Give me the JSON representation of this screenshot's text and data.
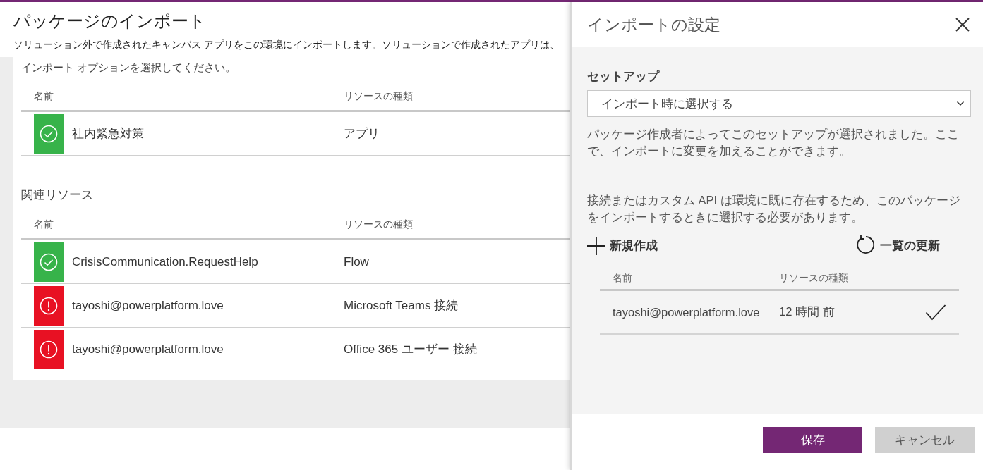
{
  "page": {
    "title": "パッケージのインポート",
    "description": "ソリューション外で作成されたキャンバス アプリをこの環境にインポートします。ソリューションで作成されたアプリは、"
  },
  "import_options": {
    "instruction": "インポート オプションを選択してください。",
    "columns": [
      "名前",
      "リソースの種類"
    ],
    "rows": [
      {
        "name": "社内緊急対策",
        "type": "アプリ",
        "kind": "success"
      }
    ]
  },
  "related_resources": {
    "title": "関連リソース",
    "columns": [
      "名前",
      "リソースの種類"
    ],
    "rows": [
      {
        "name": "CrisisCommunication.RequestHelp",
        "type": "Flow",
        "kind": "success"
      },
      {
        "name": "tayoshi@powerplatform.love",
        "type": "Microsoft Teams 接続",
        "kind": "error"
      },
      {
        "name": "tayoshi@powerplatform.love",
        "type": "Office 365 ユーザー 接続",
        "kind": "error"
      }
    ]
  },
  "settings_panel": {
    "title": "インポートの設定",
    "setup": {
      "label": "セットアップ",
      "value": "インポート時に選択する"
    },
    "setup_note": "パッケージ作成者によってこのセットアップが選択されました。ここで、インポートに変更を加えることができます。",
    "connection_note": "接続またはカスタム API は環境に既に存在するため、このパッケージをインポートするときに選択する必要があります。",
    "actions": [
      {
        "kind": "add",
        "label": "新規作成"
      },
      {
        "kind": "refresh",
        "label": "一覧の更新"
      }
    ],
    "table": {
      "columns": [
        "名前",
        "リソースの種類"
      ],
      "rows": [
        {
          "name": "tayoshi@powerplatform.love",
          "time": "12 時間 前",
          "selected": true
        }
      ]
    },
    "buttons": [
      {
        "kind": "primary",
        "label": "保存"
      },
      {
        "kind": "secondary",
        "label": "キャンセル"
      }
    ]
  }
}
